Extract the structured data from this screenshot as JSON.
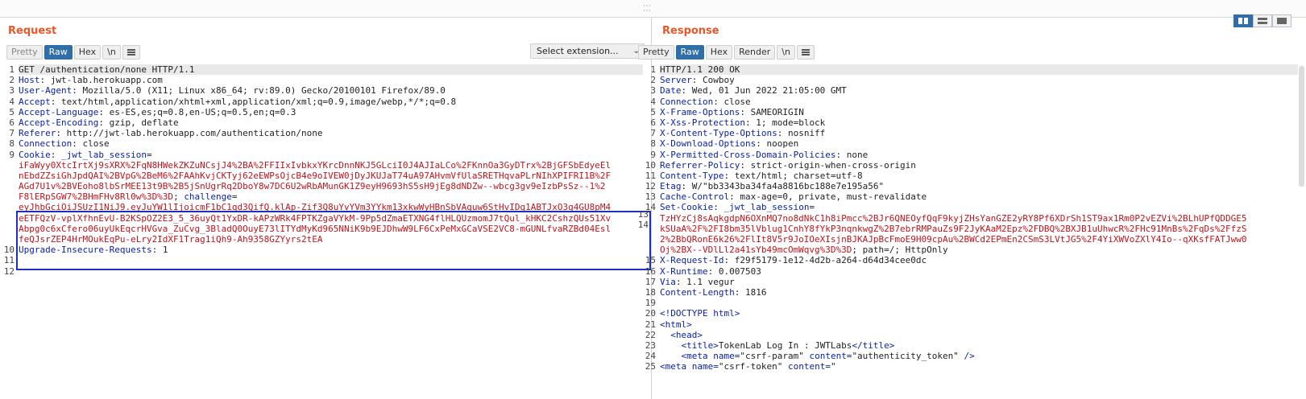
{
  "request": {
    "title": "Request",
    "toolbar": {
      "pretty": "Pretty",
      "raw": "Raw",
      "hex": "Hex",
      "newline": "\\n"
    },
    "select_extension": "Select extension...",
    "lines": [
      {
        "n": "1",
        "parts": [
          {
            "t": "GET /authentication/none HTTP/1.1",
            "c": ""
          }
        ],
        "hl": true
      },
      {
        "n": "2",
        "parts": [
          {
            "t": "Host",
            "c": "hn"
          },
          {
            "t": ": jwt-lab.herokuapp.com",
            "c": ""
          }
        ]
      },
      {
        "n": "3",
        "parts": [
          {
            "t": "User-Agent",
            "c": "hn"
          },
          {
            "t": ": Mozilla/5.0 (X11; Linux x86_64; rv:89.0) Gecko/20100101 Firefox/89.0",
            "c": ""
          }
        ]
      },
      {
        "n": "4",
        "parts": [
          {
            "t": "Accept",
            "c": "hn"
          },
          {
            "t": ": text/html,application/xhtml+xml,application/xml;q=0.9,image/webp,*/*;q=0.8",
            "c": ""
          }
        ]
      },
      {
        "n": "5",
        "parts": [
          {
            "t": "Accept-Language",
            "c": "hn"
          },
          {
            "t": ": es-ES,es;q=0.8,en-US;q=0.5,en;q=0.3",
            "c": ""
          }
        ]
      },
      {
        "n": "6",
        "parts": [
          {
            "t": "Accept-Encoding",
            "c": "hn"
          },
          {
            "t": ": gzip, deflate",
            "c": ""
          }
        ]
      },
      {
        "n": "7",
        "parts": [
          {
            "t": "Referer",
            "c": "hn"
          },
          {
            "t": ": http://jwt-lab.herokuapp.com/authentication/none",
            "c": ""
          }
        ]
      },
      {
        "n": "8",
        "parts": [
          {
            "t": "Connection",
            "c": "hn"
          },
          {
            "t": ": close",
            "c": ""
          }
        ]
      },
      {
        "n": "9",
        "parts": [
          {
            "t": "Cookie",
            "c": "hn"
          },
          {
            "t": ": ",
            "c": ""
          },
          {
            "t": "_jwt_lab_session",
            "c": "hn"
          },
          {
            "t": "=",
            "c": ""
          }
        ]
      },
      {
        "n": "",
        "parts": [
          {
            "t": "iFaWyy0XtcIrtXj9sXRX%2FqN8HWekZKZuNCsjJ4%2BA%2FFIIxIvbkxYKrcDnnNKJ5GLciI0J4AJIaLCo%2FKnnOa3GyDTrx%2BjGFSbEdyeEl",
            "c": "red"
          }
        ]
      },
      {
        "n": "",
        "parts": [
          {
            "t": "nEbdZZsiGhJpdQAI%2BVpG%2BeM6%2FAAhKvjCKTyj62eEWPsOjcB4e9oIVEW0jDyJKUJaT74uA97AHvmVfUlaSRETHqvaPLrNIhXPIFRI1B%2F",
            "c": "red"
          }
        ]
      },
      {
        "n": "",
        "parts": [
          {
            "t": "AGd7U1v%2BVEoho8lbSrMEE13t9B%2B5jSnUgrRq2DboY8w7DC6U2wRbAMunGK1Z9eyH9693hS5sH9jEg8dNDZw--wbcg3gv9eIzbPsSz--1%2",
            "c": "red"
          }
        ]
      },
      {
        "n": "",
        "parts": [
          {
            "t": "F8lERpSGW7%2BHmFHv8Rl0w%3D%3D",
            "c": "red"
          },
          {
            "t": "; ",
            "c": ""
          },
          {
            "t": "challenge",
            "c": "hn"
          },
          {
            "t": "=",
            "c": ""
          }
        ]
      },
      {
        "n": "",
        "parts": [
          {
            "t": "eyJhbGciOiJSUzI1NiJ9.eyJuYW1lIjoicmF1bC1qd3QifQ.klAp-Zif3Q8uYvYVm3YYkm13xkwWyHBnSbVAguw6StHvIDg1ABTJxO3g4GU8pM4",
            "c": "red"
          }
        ]
      },
      {
        "n": "",
        "parts": [
          {
            "t": "eETFQzV-vplXfhnEvU-B2KSpOZ2E3_5_36uyQt1YxDR-kAPzWRk4FPTKZgaVYkM-9Pp5dZmaETXNG4flHLQUzmomJ7tQul_kHKC2CshzQUs51Xv",
            "c": "red"
          }
        ]
      },
      {
        "n": "",
        "parts": [
          {
            "t": "Abpg0c6xCfero06uyUkEqcrHVGva_ZuCvg_3BladQ0OuyE73lITYdMyKd965NNiK9b9EJDhwW9LF6CxPeMxGCaVSE2VC8-mGUNLfvaRZBd04Esl",
            "c": "red"
          }
        ]
      },
      {
        "n": "",
        "parts": [
          {
            "t": "feQJsrZEP4HrMOukEqPu-eLry2IdXF1Trag1iQh9-Ah9358GZYyrs2tEA",
            "c": "red"
          }
        ]
      },
      {
        "n": "10",
        "parts": [
          {
            "t": "Upgrade-Insecure-Requests",
            "c": "hn"
          },
          {
            "t": ": 1",
            "c": ""
          }
        ]
      },
      {
        "n": "11",
        "parts": [
          {
            "t": "",
            "c": ""
          }
        ]
      },
      {
        "n": "12",
        "parts": [
          {
            "t": "",
            "c": ""
          }
        ]
      }
    ],
    "side_marks": [
      "13",
      "14"
    ]
  },
  "response": {
    "title": "Response",
    "toolbar": {
      "pretty": "Pretty",
      "raw": "Raw",
      "hex": "Hex",
      "render": "Render",
      "newline": "\\n"
    },
    "lines": [
      {
        "n": "1",
        "parts": [
          {
            "t": "HTTP/1.1 200 OK",
            "c": ""
          }
        ],
        "hl": true
      },
      {
        "n": "2",
        "parts": [
          {
            "t": "Server",
            "c": "hn"
          },
          {
            "t": ": Cowboy",
            "c": ""
          }
        ]
      },
      {
        "n": "3",
        "parts": [
          {
            "t": "Date",
            "c": "hn"
          },
          {
            "t": ": Wed, 01 Jun 2022 21:05:00 GMT",
            "c": ""
          }
        ]
      },
      {
        "n": "4",
        "parts": [
          {
            "t": "Connection",
            "c": "hn"
          },
          {
            "t": ": close",
            "c": ""
          }
        ]
      },
      {
        "n": "5",
        "parts": [
          {
            "t": "X-Frame-Options",
            "c": "hn"
          },
          {
            "t": ": SAMEORIGIN",
            "c": ""
          }
        ]
      },
      {
        "n": "6",
        "parts": [
          {
            "t": "X-Xss-Protection",
            "c": "hn"
          },
          {
            "t": ": 1; mode=block",
            "c": ""
          }
        ]
      },
      {
        "n": "7",
        "parts": [
          {
            "t": "X-Content-Type-Options",
            "c": "hn"
          },
          {
            "t": ": nosniff",
            "c": ""
          }
        ]
      },
      {
        "n": "8",
        "parts": [
          {
            "t": "X-Download-Options",
            "c": "hn"
          },
          {
            "t": ": noopen",
            "c": ""
          }
        ]
      },
      {
        "n": "9",
        "parts": [
          {
            "t": "X-Permitted-Cross-Domain-Policies",
            "c": "hn"
          },
          {
            "t": ": none",
            "c": ""
          }
        ]
      },
      {
        "n": "10",
        "parts": [
          {
            "t": "Referrer-Policy",
            "c": "hn"
          },
          {
            "t": ": strict-origin-when-cross-origin",
            "c": ""
          }
        ]
      },
      {
        "n": "11",
        "parts": [
          {
            "t": "Content-Type",
            "c": "hn"
          },
          {
            "t": ": text/html; charset=utf-8",
            "c": ""
          }
        ]
      },
      {
        "n": "12",
        "parts": [
          {
            "t": "Etag",
            "c": "hn"
          },
          {
            "t": ": W/\"bb3343ba34fa4a8816bc188e7e195a56\"",
            "c": ""
          }
        ]
      },
      {
        "n": "13",
        "parts": [
          {
            "t": "Cache-Control",
            "c": "hn"
          },
          {
            "t": ": max-age=0, private, must-revalidate",
            "c": ""
          }
        ]
      },
      {
        "n": "14",
        "parts": [
          {
            "t": "Set-Cookie",
            "c": "hn"
          },
          {
            "t": ": ",
            "c": ""
          },
          {
            "t": "_jwt_lab_session",
            "c": "hn"
          },
          {
            "t": "=",
            "c": ""
          }
        ]
      },
      {
        "n": "",
        "parts": [
          {
            "t": "TzHYzCj8sAqkgdpN6OXnMQ7no8dNkC1h8iPmcc%2BJr6QNEOyfQqF9kyjZHsYanGZE2yRY8Pf6XDrSh1ST9ax1Rm0P2vEZVi%2BLhUPfQDDGE5",
            "c": "red"
          }
        ]
      },
      {
        "n": "",
        "parts": [
          {
            "t": "kSUaA%2F%2FI8bm35lVblug1CnhY8fYkP3nqnkwgZ%2B7ebrRMPauZs9F2JyKAaM2Epz%2FDBQ%2BXJB1uUhwcR%2FHc91MnBs%2FqDs%2FfzS",
            "c": "red"
          }
        ]
      },
      {
        "n": "",
        "parts": [
          {
            "t": "2%2BbQRonE6k26%2FlIt8V5r9JoIOeXIsjnBJKAJpBcFmoE9H09cpAu%2BWCd2EPmEn2CSmS3LVtJG5%2F4YiXWVoZXlY4Io--qXKsfFATJww0",
            "c": "red"
          }
        ]
      },
      {
        "n": "",
        "parts": [
          {
            "t": "Oj%2BX--VDlLl2a41sYb49mcOmWqvg%3D%3D",
            "c": "red"
          },
          {
            "t": "; path=/; HttpOnly",
            "c": ""
          }
        ]
      },
      {
        "n": "15",
        "parts": [
          {
            "t": "X-Request-Id",
            "c": "hn"
          },
          {
            "t": ": f29f5179-1e12-4d2b-a264-d64d34cee0dc",
            "c": ""
          }
        ]
      },
      {
        "n": "16",
        "parts": [
          {
            "t": "X-Runtime",
            "c": "hn"
          },
          {
            "t": ": 0.007503",
            "c": ""
          }
        ]
      },
      {
        "n": "17",
        "parts": [
          {
            "t": "Via",
            "c": "hn"
          },
          {
            "t": ": 1.1 vegur",
            "c": ""
          }
        ]
      },
      {
        "n": "18",
        "parts": [
          {
            "t": "Content-Length",
            "c": "hn"
          },
          {
            "t": ": 1816",
            "c": ""
          }
        ]
      },
      {
        "n": "19",
        "parts": [
          {
            "t": "",
            "c": ""
          }
        ]
      },
      {
        "n": "20",
        "parts": [
          {
            "t": "<!DOCTYPE html>",
            "c": "tag"
          }
        ]
      },
      {
        "n": "21",
        "parts": [
          {
            "t": "<html>",
            "c": "tag"
          }
        ]
      },
      {
        "n": "22",
        "parts": [
          {
            "t": "  <head>",
            "c": "tag"
          }
        ]
      },
      {
        "n": "23",
        "parts": [
          {
            "t": "    <title>",
            "c": "tag"
          },
          {
            "t": "TokenLab Log In : JWTLabs",
            "c": ""
          },
          {
            "t": "</title>",
            "c": "tag"
          }
        ]
      },
      {
        "n": "24",
        "parts": [
          {
            "t": "    <meta ",
            "c": "tag"
          },
          {
            "t": "name=",
            "c": "tag"
          },
          {
            "t": "\"csrf-param\" ",
            "c": ""
          },
          {
            "t": "content=",
            "c": "tag"
          },
          {
            "t": "\"authenticity_token\" ",
            "c": ""
          },
          {
            "t": "/>",
            "c": "tag"
          }
        ]
      },
      {
        "n": "25",
        "parts": [
          {
            "t": "<meta ",
            "c": "tag"
          },
          {
            "t": "name=",
            "c": "tag"
          },
          {
            "t": "\"csrf-token\" ",
            "c": ""
          },
          {
            "t": "content=",
            "c": "tag"
          },
          {
            "t": "\"",
            "c": ""
          }
        ]
      }
    ]
  },
  "layout_toggles": [
    "split-horizontal",
    "split-vertical",
    "single"
  ],
  "colors": {
    "accent": "#e8572a",
    "active_button": "#2f6ea6",
    "header_name": "#0b22a8",
    "value_red": "#c0141c",
    "selection": "#1d2fc0"
  }
}
